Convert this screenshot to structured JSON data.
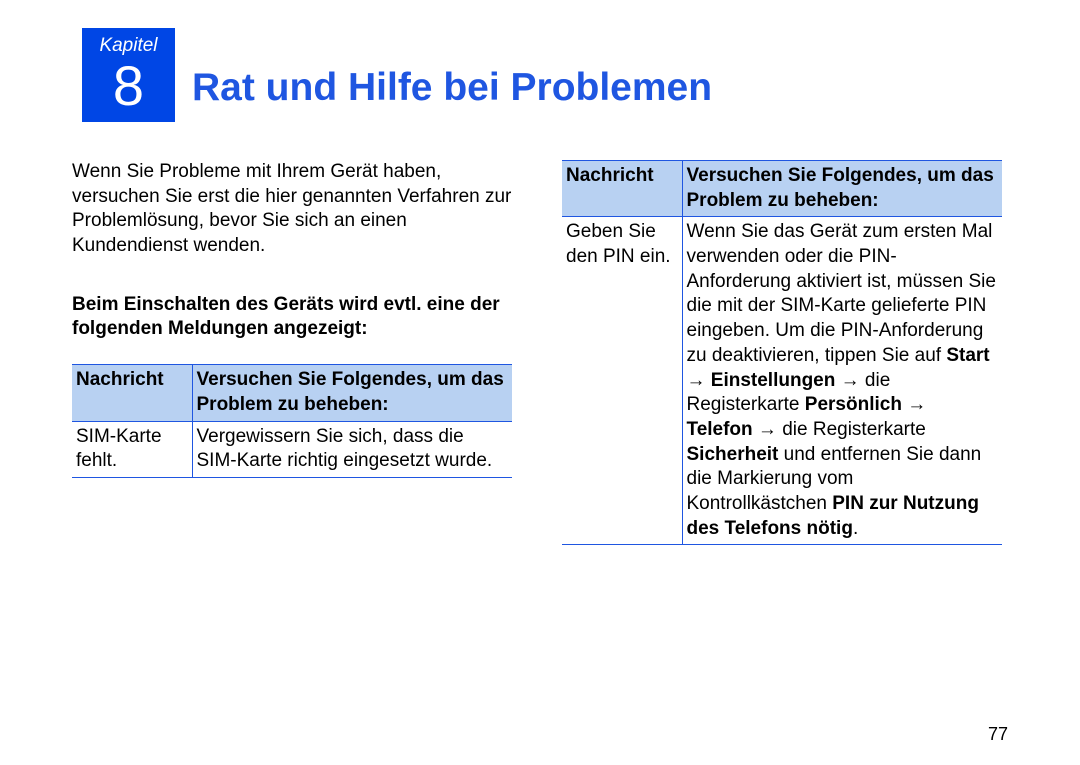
{
  "chapter": {
    "label": "Kapitel",
    "number": "8",
    "title": "Rat und Hilfe bei Problemen"
  },
  "intro": "Wenn Sie Probleme mit Ihrem Gerät haben, versuchen Sie erst die hier genannten Verfahren zur Problemlösung, bevor Sie sich an einen Kundendienst wenden.",
  "sectionHeading": "Beim Einschalten des Geräts wird evtl. eine der folgenden Meldungen angezeigt:",
  "table1": {
    "headers": {
      "message": "Nachricht",
      "solution": "Versuchen Sie Folgendes, um das Problem zu beheben:"
    },
    "row": {
      "message": "SIM-Karte fehlt.",
      "solution": "Vergewissern Sie sich, dass die SIM-Karte richtig eingesetzt wurde."
    }
  },
  "table2": {
    "headers": {
      "message": "Nachricht",
      "solution": "Versuchen Sie Folgendes, um das Problem zu beheben:"
    },
    "row": {
      "message": "Geben Sie den PIN ein.",
      "solution_parts": {
        "p1": "Wenn Sie das Gerät zum ersten Mal verwenden oder die PIN-Anforderung aktiviert ist, müssen Sie die mit der SIM-Karte gelieferte PIN eingeben. Um die PIN-Anforderung zu deaktivieren, tippen Sie auf ",
        "b1": "Start",
        "arrow1": " → ",
        "b2": "Einstellungen",
        "arrow2": " → ",
        "p2": "die Registerkarte ",
        "b3": "Persönlich",
        "arrow3": " → ",
        "b4": "Telefon",
        "arrow4": " → ",
        "p3": "die Registerkarte ",
        "b5": "Sicherheit",
        "p4": " und entfernen Sie dann die Markierung vom Kontrollkästchen ",
        "b6": "PIN zur Nutzung des Telefons nötig",
        "p5": "."
      }
    }
  },
  "pageNumber": "77"
}
